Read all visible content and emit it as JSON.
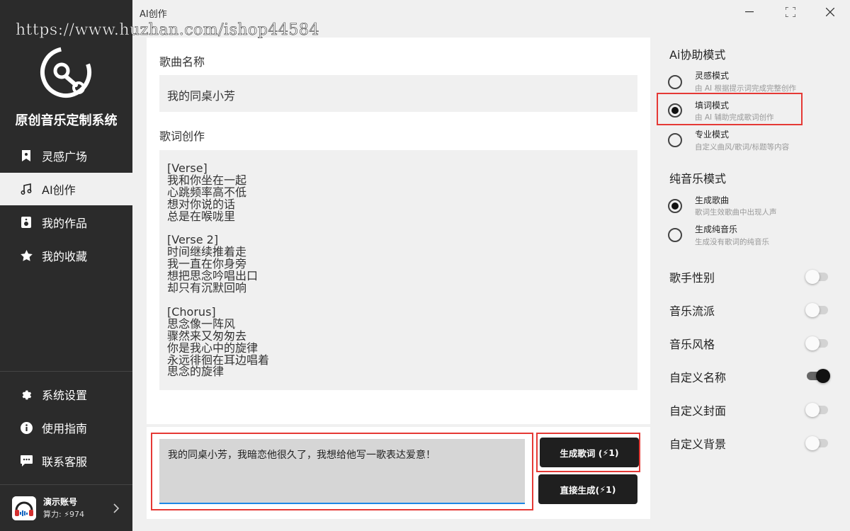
{
  "watermark": "https://www.huzhan.com/ishop44584",
  "window": {
    "title": "AI创作"
  },
  "sidebar": {
    "app_name": "原创音乐定制系统",
    "nav": [
      {
        "label": "灵感广场",
        "icon": "bookmark-icon"
      },
      {
        "label": "AI创作",
        "icon": "music-note-icon",
        "active": true
      },
      {
        "label": "我的作品",
        "icon": "speaker-icon"
      },
      {
        "label": "我的收藏",
        "icon": "star-icon"
      }
    ],
    "bottom_nav": [
      {
        "label": "系统设置",
        "icon": "gear-icon"
      },
      {
        "label": "使用指南",
        "icon": "info-icon"
      },
      {
        "label": "联系客服",
        "icon": "chat-icon"
      }
    ],
    "account": {
      "name": "演示账号",
      "power_label": "算力:",
      "power_value": "974"
    }
  },
  "main": {
    "song_name_label": "歌曲名称",
    "song_name": "我的同桌小芳",
    "lyrics_label": "歌词创作",
    "lyrics": "[Verse]\n我和你坐在一起\n心跳频率高不低\n想对你说的话\n总是在喉咙里\n\n[Verse 2]\n时间继续推着走\n我一直在你身旁\n想把思念吟唱出口\n却只有沉默回响\n\n[Chorus]\n思念像一阵风\n骤然来又匆匆去\n你是我心中的旋律\n永远徘徊在耳边唱着\n思念的旋律",
    "prompt": "我的同桌小芳，我暗恋他很久了，我想给他写一歌表达爱意！",
    "generate_lyrics_label": "生成歌词 (",
    "generate_lyrics_cost": "1)",
    "direct_generate_label": "直接生成(",
    "direct_generate_cost": "1)"
  },
  "right": {
    "ai_mode_title": "Ai协助模式",
    "ai_modes": [
      {
        "title": "灵感模式",
        "desc": "由 AI 根据提示词完成完整创作",
        "selected": false
      },
      {
        "title": "填词模式",
        "desc": "由 AI 辅助完成歌词创作",
        "selected": true
      },
      {
        "title": "专业模式",
        "desc": "自定义曲风/歌词/标题等内容",
        "selected": false
      }
    ],
    "music_mode_title": "纯音乐模式",
    "music_modes": [
      {
        "title": "生成歌曲",
        "desc": "歌词生效歌曲中出现人声",
        "selected": true
      },
      {
        "title": "生成纯音乐",
        "desc": "生成没有歌词的纯音乐",
        "selected": false
      }
    ],
    "toggles": [
      {
        "label": "歌手性别",
        "on": false
      },
      {
        "label": "音乐流派",
        "on": false
      },
      {
        "label": "音乐风格",
        "on": false
      },
      {
        "label": "自定义名称",
        "on": true
      },
      {
        "label": "自定义封面",
        "on": false
      },
      {
        "label": "自定义背景",
        "on": false
      }
    ]
  },
  "colors": {
    "sidebar_bg": "#2b2b2b",
    "highlight_border": "#e53935",
    "button_bg": "#1f1f1f",
    "input_focus": "#1e88e5"
  }
}
